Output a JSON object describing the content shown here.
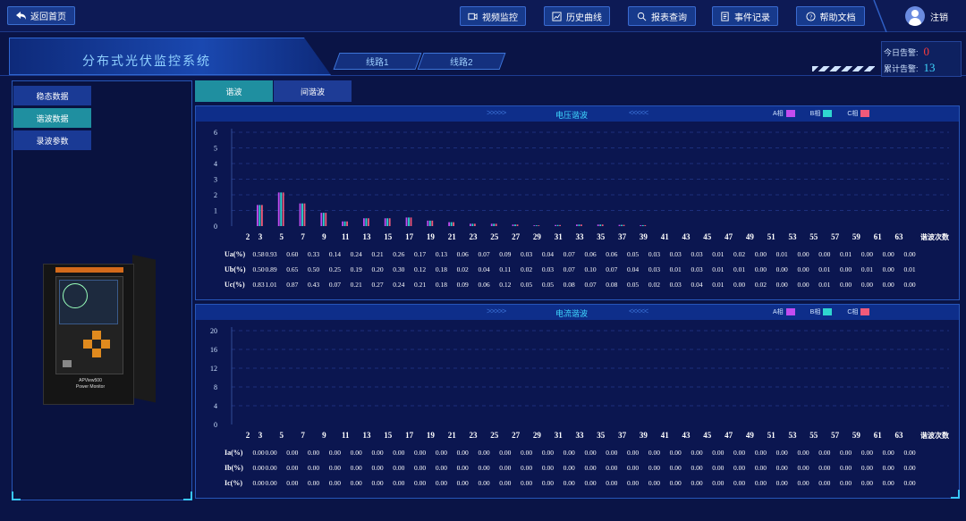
{
  "header": {
    "back_label": "返回首页",
    "nav": [
      {
        "label": "视频监控",
        "icon": "video-icon"
      },
      {
        "label": "历史曲线",
        "icon": "chart-icon"
      },
      {
        "label": "报表查询",
        "icon": "search-icon"
      },
      {
        "label": "事件记录",
        "icon": "document-icon"
      },
      {
        "label": "帮助文档",
        "icon": "help-icon"
      }
    ],
    "user_label": "注销"
  },
  "system_title": "分布式光伏监控系统",
  "line_tabs": [
    "线路1",
    "线路2"
  ],
  "alarms": {
    "today_label": "今日告警:",
    "today_value": "0",
    "total_label": "累计告警:",
    "total_value": "13",
    "today_color": "#ff3b3b",
    "total_color": "#3fd7ff"
  },
  "sidebar": {
    "items": [
      {
        "label": "稳态数据",
        "active": false
      },
      {
        "label": "谐波数据",
        "active": true
      },
      {
        "label": "录波参数",
        "active": false
      }
    ],
    "device_label_1": "APView500",
    "device_label_2": "Power Monitor"
  },
  "tabs": [
    {
      "label": "谐波",
      "active": true
    },
    {
      "label": "间谐波",
      "active": false
    }
  ],
  "colors": {
    "A": "#c24cf0",
    "B": "#2fd6cf",
    "C": "#f05a7a"
  },
  "legend": [
    "A相",
    "B相",
    "C相"
  ],
  "chart_data": [
    {
      "type": "bar",
      "title": "电压谐波",
      "xlabel": "谐波次数",
      "ylim": [
        0,
        6
      ],
      "yticks": [
        0,
        1,
        2,
        3,
        4,
        5,
        6
      ],
      "categories": [
        "2",
        "3",
        "5",
        "7",
        "9",
        "11",
        "13",
        "15",
        "17",
        "19",
        "21",
        "23",
        "25",
        "27",
        "29",
        "31",
        "33",
        "35",
        "37",
        "39",
        "41",
        "43",
        "45",
        "47",
        "49",
        "51",
        "53",
        "55",
        "57",
        "59",
        "61",
        "63"
      ],
      "series": [
        {
          "name": "A相",
          "row_label": "Ua(%)",
          "values": [
            0.58,
            0.93,
            0.6,
            0.33,
            0.14,
            0.24,
            0.21,
            0.26,
            0.17,
            0.13,
            0.06,
            0.07,
            0.09,
            0.03,
            0.04,
            0.07,
            0.06,
            0.06,
            0.05,
            0.03,
            0.03,
            0.03,
            0.01,
            0.02,
            0.0,
            0.01,
            0.0,
            0.0,
            0.01,
            0.0,
            0.0,
            0.0
          ]
        },
        {
          "name": "B相",
          "row_label": "Ub(%)",
          "values": [
            0.5,
            0.89,
            0.65,
            0.5,
            0.25,
            0.19,
            0.2,
            0.3,
            0.12,
            0.18,
            0.02,
            0.04,
            0.11,
            0.02,
            0.03,
            0.07,
            0.1,
            0.07,
            0.04,
            0.03,
            0.01,
            0.03,
            0.01,
            0.01,
            0.0,
            0.0,
            0.0,
            0.01,
            0.0,
            0.01,
            0.0,
            0.01
          ]
        },
        {
          "name": "C相",
          "row_label": "Uc(%)",
          "values": [
            0.83,
            1.01,
            0.87,
            0.43,
            0.07,
            0.21,
            0.27,
            0.24,
            0.21,
            0.18,
            0.09,
            0.06,
            0.12,
            0.05,
            0.05,
            0.08,
            0.07,
            0.08,
            0.05,
            0.02,
            0.03,
            0.04,
            0.01,
            0.0,
            0.02,
            0.0,
            0.0,
            0.01,
            0.0,
            0.0,
            0.0,
            0.0
          ]
        }
      ],
      "bar_heights": [
        0,
        1.35,
        2.15,
        1.45,
        0.85,
        0.3,
        0.5,
        0.5,
        0.55,
        0.35,
        0.25,
        0.15,
        0.15,
        0.1,
        0.05,
        0.07,
        0.1,
        0.1,
        0.08,
        0.06,
        0,
        0,
        0,
        0,
        0,
        0,
        0,
        0,
        0,
        0,
        0,
        0
      ]
    },
    {
      "type": "bar",
      "title": "电流谐波",
      "xlabel": "谐波次数",
      "ylim": [
        0,
        20
      ],
      "yticks": [
        0,
        4,
        8,
        12,
        16,
        20
      ],
      "categories": [
        "2",
        "3",
        "5",
        "7",
        "9",
        "11",
        "13",
        "15",
        "17",
        "19",
        "21",
        "23",
        "25",
        "27",
        "29",
        "31",
        "33",
        "35",
        "37",
        "39",
        "41",
        "43",
        "45",
        "47",
        "49",
        "51",
        "53",
        "55",
        "57",
        "59",
        "61",
        "63"
      ],
      "series": [
        {
          "name": "A相",
          "row_label": "Ia(%)",
          "values": [
            0,
            0,
            0,
            0,
            0,
            0,
            0,
            0,
            0,
            0,
            0,
            0,
            0,
            0,
            0,
            0,
            0,
            0,
            0,
            0,
            0,
            0,
            0,
            0,
            0,
            0,
            0,
            0,
            0,
            0,
            0,
            0
          ]
        },
        {
          "name": "B相",
          "row_label": "Ib(%)",
          "values": [
            0,
            0,
            0,
            0,
            0,
            0,
            0,
            0,
            0,
            0,
            0,
            0,
            0,
            0,
            0,
            0,
            0,
            0,
            0,
            0,
            0,
            0,
            0,
            0,
            0,
            0,
            0,
            0,
            0,
            0,
            0,
            0
          ]
        },
        {
          "name": "C相",
          "row_label": "Ic(%)",
          "values": [
            0,
            0,
            0,
            0,
            0,
            0,
            0,
            0,
            0,
            0,
            0,
            0,
            0,
            0,
            0,
            0,
            0,
            0,
            0,
            0,
            0,
            0,
            0,
            0,
            0,
            0,
            0,
            0,
            0,
            0,
            0,
            0
          ]
        }
      ]
    }
  ]
}
